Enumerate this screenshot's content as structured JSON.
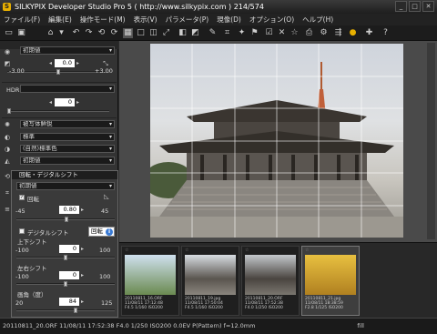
{
  "window": {
    "title": "SILKYPIX Developer Studio Pro 5 ( http://www.silkypix.com )  214/574"
  },
  "menu": [
    "ファイル(F)",
    "編集(E)",
    "操作モード(M)",
    "表示(V)",
    "パラメータ(P)",
    "現像(D)",
    "オプション(O)",
    "ヘルプ(H)"
  ],
  "left": {
    "preset1": "初期値",
    "slider1": {
      "value": "0.0",
      "min": "-3.00",
      "max": "+3.00",
      "level": 0.5
    },
    "hdr_label": "HDR",
    "slider2": {
      "value": "0",
      "level": 0.0
    },
    "sharp_preset": "被写体鮮鋭",
    "tone_preset": "標準",
    "color_preset": "(自然)標準色",
    "preset5": "初期値",
    "sub": {
      "header": "回転・デジタルシフト",
      "preset": "初期値",
      "rotate_label": "回転",
      "rotate": {
        "min": "-45",
        "value": "0.80",
        "max": "45",
        "level": 0.509
      },
      "shift_label": "デジタルシフト",
      "ud_label": "上下シフト",
      "ud": {
        "min": "-100",
        "value": "0",
        "max": "100",
        "level": 0.5
      },
      "lr_label": "左右シフト",
      "lr": {
        "min": "-100",
        "value": "0",
        "max": "100",
        "level": 0.5
      },
      "angle_label": "画角（度）",
      "angle": {
        "min": "20",
        "value": "84",
        "max": "125",
        "level": 0.61
      }
    },
    "tooltip": "回転"
  },
  "thumbs": [
    {
      "caption": "20110811_16.ORF\n11/08/11 17:12:48\nF4.5 1/160 ISO200",
      "selected": false
    },
    {
      "caption": "20110811_19.jpg\n11/08/11 17:50:04\nF4.5 1/160 ISO200",
      "selected": false
    },
    {
      "caption": "20110811_20.ORF\n11/08/11 17:52:38\nF4.0 1/250 ISO200",
      "selected": true
    },
    {
      "caption": "20110811_21.jpg\n11/08/11 18:38:59\nF2.8 1/125 ISO200",
      "selected": false
    }
  ],
  "status": {
    "text": "20110811_20.ORF  11/08/11 17:52:38  F4.0  1/250  ISO200   0.0EV  P(Pattern)  f=12.0mm",
    "right": "fill"
  },
  "colors": {
    "accent": "#3a7bd5",
    "sky": "#d9dce0"
  }
}
